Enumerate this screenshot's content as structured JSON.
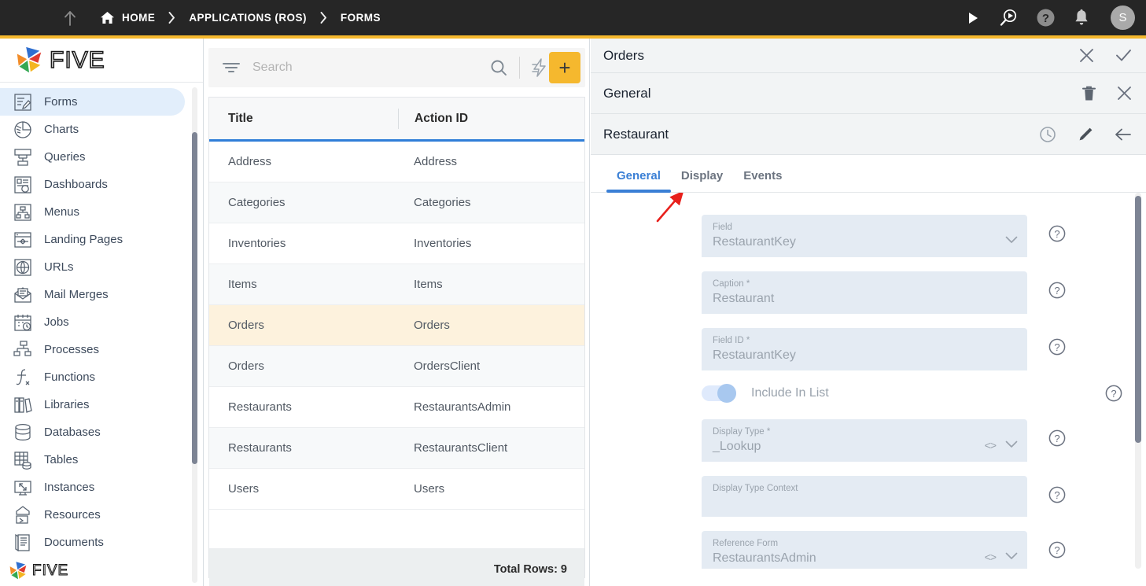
{
  "topbar": {
    "menu_icon": "hamburger-icon",
    "up_icon": "up-arrow-icon",
    "breadcrumbs": [
      {
        "label": "HOME",
        "icon": "home-icon"
      },
      {
        "label": "APPLICATIONS (ROS)",
        "icon": ""
      },
      {
        "label": "FORMS",
        "icon": ""
      }
    ],
    "separator": "›",
    "actions": [
      {
        "name": "run-icon",
        "label": "Run"
      },
      {
        "name": "debug-run-icon",
        "label": "Debug"
      },
      {
        "name": "help-icon",
        "label": "Help"
      },
      {
        "name": "notifications-bell-icon",
        "label": "Notifications"
      }
    ],
    "avatar_initial": "S",
    "accent_color": "#F5B82E",
    "background_color": "#262626"
  },
  "sidebar": {
    "logo_text": "FIVE",
    "bottom_logo_text": "FIVE",
    "active_item": "Forms",
    "items": [
      {
        "label": "Forms",
        "icon": "forms-icon"
      },
      {
        "label": "Charts",
        "icon": "charts-icon"
      },
      {
        "label": "Queries",
        "icon": "queries-icon"
      },
      {
        "label": "Dashboards",
        "icon": "dashboards-icon"
      },
      {
        "label": "Menus",
        "icon": "menus-icon"
      },
      {
        "label": "Landing Pages",
        "icon": "landing-pages-icon"
      },
      {
        "label": "URLs",
        "icon": "urls-icon"
      },
      {
        "label": "Mail Merges",
        "icon": "mail-merges-icon"
      },
      {
        "label": "Jobs",
        "icon": "jobs-icon"
      },
      {
        "label": "Processes",
        "icon": "processes-icon"
      },
      {
        "label": "Functions",
        "icon": "functions-icon"
      },
      {
        "label": "Libraries",
        "icon": "libraries-icon"
      },
      {
        "label": "Databases",
        "icon": "databases-icon"
      },
      {
        "label": "Tables",
        "icon": "tables-icon"
      },
      {
        "label": "Instances",
        "icon": "instances-icon"
      },
      {
        "label": "Resources",
        "icon": "resources-icon"
      },
      {
        "label": "Documents",
        "icon": "documents-icon"
      }
    ]
  },
  "list_panel": {
    "search": {
      "placeholder": "Search",
      "value": ""
    },
    "filter_icon": "filter-icon",
    "search_icon": "search-icon",
    "lightning_icon": "lightning-bolt-icon",
    "add_label": "+",
    "add_color": "#F5B82E",
    "columns": [
      "Title",
      "Action ID"
    ],
    "rows": [
      {
        "title": "Address",
        "action_id": "Address"
      },
      {
        "title": "Categories",
        "action_id": "Categories"
      },
      {
        "title": "Inventories",
        "action_id": "Inventories"
      },
      {
        "title": "Items",
        "action_id": "Items"
      },
      {
        "title": "Orders",
        "action_id": "Orders"
      },
      {
        "title": "Orders",
        "action_id": "OrdersClient"
      },
      {
        "title": "Restaurants",
        "action_id": "RestaurantsAdmin"
      },
      {
        "title": "Restaurants",
        "action_id": "RestaurantsClient"
      },
      {
        "title": "Users",
        "action_id": "Users"
      }
    ],
    "selected_row_index": 4,
    "footer": "Total Rows: 9"
  },
  "detail_panel": {
    "header_primary": {
      "title": "Orders",
      "icons": [
        {
          "name": "close-icon",
          "glyph": "✕"
        },
        {
          "name": "confirm-check-icon",
          "glyph": "✓"
        }
      ]
    },
    "header_secondary": {
      "title": "General",
      "icons": [
        {
          "name": "delete-trash-icon",
          "glyph": "🗑"
        },
        {
          "name": "close-icon",
          "glyph": "✕"
        }
      ]
    },
    "header_tertiary": {
      "title": "Restaurant",
      "icons": [
        {
          "name": "history-clock-icon",
          "glyph": "◴"
        },
        {
          "name": "edit-pencil-icon",
          "glyph": "✎"
        },
        {
          "name": "back-arrow-icon",
          "glyph": "←"
        }
      ]
    },
    "tabs": [
      {
        "label": "General",
        "active": true
      },
      {
        "label": "Display",
        "active": false
      },
      {
        "label": "Events",
        "active": false
      }
    ],
    "active_tab_color": "#3a7fd5",
    "fields": [
      {
        "label": "Field",
        "value": "RestaurantKey",
        "has_dropdown": true,
        "has_code": false
      },
      {
        "label": "Caption *",
        "value": "Restaurant",
        "has_dropdown": false,
        "has_code": false
      },
      {
        "label": "Field ID *",
        "value": "RestaurantKey",
        "has_dropdown": false,
        "has_code": false
      }
    ],
    "toggle": {
      "label": "Include In List",
      "on": true
    },
    "fields_lower": [
      {
        "label": "Display Type *",
        "value": "_Lookup",
        "has_dropdown": true,
        "has_code": true
      },
      {
        "label": "Display Type Context",
        "value": "",
        "has_dropdown": false,
        "has_code": false
      },
      {
        "label": "Reference Form",
        "value": "RestaurantsAdmin",
        "has_dropdown": true,
        "has_code": true
      }
    ],
    "help_icon": "help-circle-icon"
  },
  "annotation": {
    "arrow_color": "#e8201c",
    "points_to": "Display"
  }
}
